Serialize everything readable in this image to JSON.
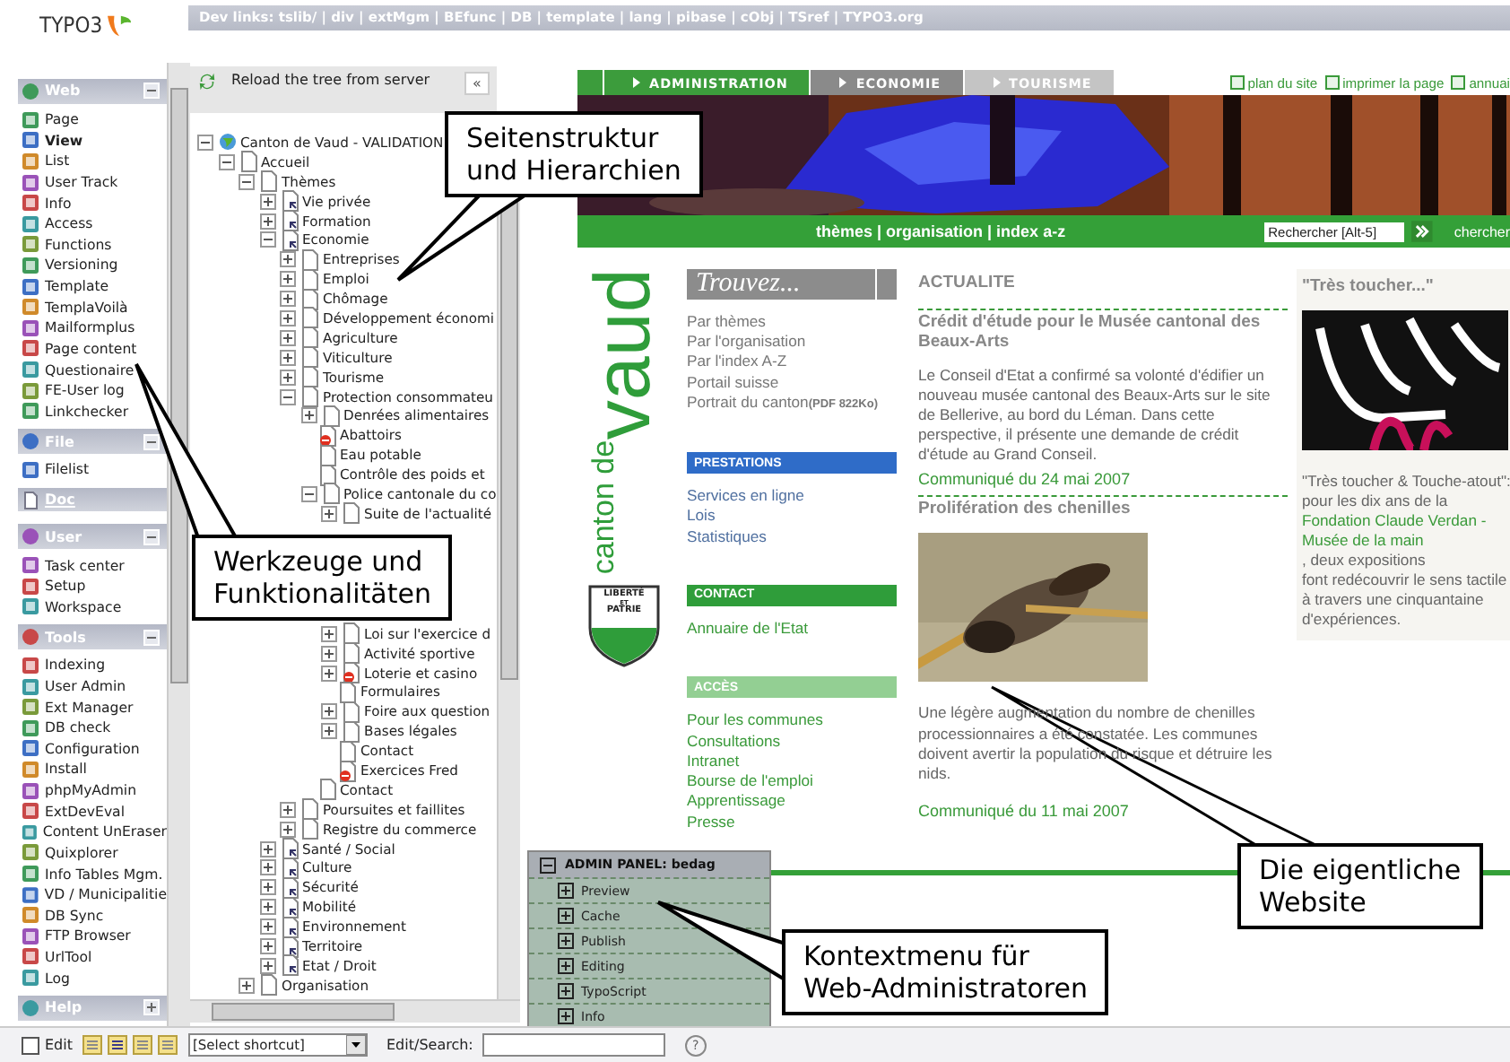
{
  "logo": {
    "text": "TYPO3"
  },
  "dev_links": "Dev links: tslib/ | div | extMgm | BEfunc | DB | template | lang | pibase | cObj | TSref | TYPO3.org",
  "module_menu": {
    "groups": [
      {
        "kind": "group",
        "title": "Web",
        "expanded": true,
        "items": [
          {
            "label": "Page",
            "selected": false
          },
          {
            "label": "View",
            "selected": true
          },
          {
            "label": "List",
            "selected": false
          },
          {
            "label": "User Track",
            "selected": false
          },
          {
            "label": "Info",
            "selected": false
          },
          {
            "label": "Access",
            "selected": false
          },
          {
            "label": "Functions",
            "selected": false
          },
          {
            "label": "Versioning",
            "selected": false
          },
          {
            "label": "Template",
            "selected": false
          },
          {
            "label": "TemplaVoilà",
            "selected": false
          },
          {
            "label": "Mailformplus",
            "selected": false
          },
          {
            "label": "Page content",
            "selected": false
          },
          {
            "label": "Questionaire",
            "selected": false
          },
          {
            "label": "FE-User log",
            "selected": false
          },
          {
            "label": "Linkchecker",
            "selected": false
          }
        ]
      },
      {
        "kind": "group",
        "title": "File",
        "expanded": true,
        "items": [
          {
            "label": "Filelist",
            "selected": false
          }
        ]
      },
      {
        "kind": "link",
        "title": "Doc"
      },
      {
        "kind": "group",
        "title": "User",
        "expanded": true,
        "items": [
          {
            "label": "Task center",
            "selected": false
          },
          {
            "label": "Setup",
            "selected": false
          },
          {
            "label": "Workspace",
            "selected": false
          }
        ]
      },
      {
        "kind": "group",
        "title": "Tools",
        "expanded": true,
        "items": [
          {
            "label": "Indexing",
            "selected": false
          },
          {
            "label": "User Admin",
            "selected": false
          },
          {
            "label": "Ext Manager",
            "selected": false
          },
          {
            "label": "DB check",
            "selected": false
          },
          {
            "label": "Configuration",
            "selected": false
          },
          {
            "label": "Install",
            "selected": false
          },
          {
            "label": "phpMyAdmin",
            "selected": false
          },
          {
            "label": "ExtDevEval",
            "selected": false
          },
          {
            "label": "Content UnEraser",
            "selected": false
          },
          {
            "label": "Quixplorer",
            "selected": false
          },
          {
            "label": "Info Tables Mgm.",
            "selected": false
          },
          {
            "label": "VD / Municipalitie",
            "selected": false
          },
          {
            "label": "DB Sync",
            "selected": false
          },
          {
            "label": "FTP Browser",
            "selected": false
          },
          {
            "label": "UrlTool",
            "selected": false
          },
          {
            "label": "Log",
            "selected": false
          }
        ]
      },
      {
        "kind": "group",
        "title": "Help",
        "expanded": false
      }
    ]
  },
  "page_tree": {
    "reload_label": "Reload the tree from server",
    "collapse_button": "«",
    "nodes": [
      {
        "label": "Canton de Vaud - VALIDATION",
        "kind": "root",
        "expanded": true,
        "children": [
          {
            "label": "Accueil",
            "kind": "page",
            "expanded": true,
            "children": [
              {
                "label": "Thèmes",
                "kind": "page",
                "expanded": true,
                "children": [
                  {
                    "label": "Vie privée",
                    "kind": "shortcut",
                    "expanded": false
                  },
                  {
                    "label": "Formation",
                    "kind": "shortcut",
                    "expanded": false
                  },
                  {
                    "label": "Economie",
                    "kind": "shortcut",
                    "expanded": true,
                    "children": [
                      {
                        "label": "Entreprises",
                        "kind": "page",
                        "expanded": false
                      },
                      {
                        "label": "Emploi",
                        "kind": "page",
                        "expanded": false
                      },
                      {
                        "label": "Chômage",
                        "kind": "page",
                        "expanded": false
                      },
                      {
                        "label": "Développement économi",
                        "kind": "page",
                        "expanded": false
                      },
                      {
                        "label": "Agriculture",
                        "kind": "page",
                        "expanded": false
                      },
                      {
                        "label": "Viticulture",
                        "kind": "page",
                        "expanded": false
                      },
                      {
                        "label": "Tourisme",
                        "kind": "page",
                        "expanded": false
                      },
                      {
                        "label": "Protection consommateu",
                        "kind": "page",
                        "expanded": true,
                        "children": [
                          {
                            "label": "Denrées alimentaires",
                            "kind": "page",
                            "expanded": false
                          },
                          {
                            "label": "Abattoirs",
                            "kind": "hidden"
                          },
                          {
                            "label": "Eau potable",
                            "kind": "page"
                          },
                          {
                            "label": "Contrôle des poids et",
                            "kind": "page"
                          },
                          {
                            "label": "Police cantonale du co",
                            "kind": "page",
                            "expanded": true,
                            "children": [
                              {
                                "label": "Suite de l'actualité",
                                "kind": "page",
                                "expanded": false
                              },
                              {
                                "label": "Loi sur l'exercice d",
                                "kind": "page",
                                "expanded": false
                              },
                              {
                                "label": "Activité sportive",
                                "kind": "page",
                                "expanded": false
                              },
                              {
                                "label": "Loterie et casino",
                                "kind": "hidden",
                                "expanded": false
                              },
                              {
                                "label": "Formulaires",
                                "kind": "page"
                              },
                              {
                                "label": "Foire aux question",
                                "kind": "page",
                                "expanded": false
                              },
                              {
                                "label": "Bases légales",
                                "kind": "page",
                                "expanded": false
                              },
                              {
                                "label": "Contact",
                                "kind": "page"
                              },
                              {
                                "label": "Exercices Fred",
                                "kind": "hidden"
                              }
                            ]
                          },
                          {
                            "label": "Contact",
                            "kind": "page"
                          }
                        ]
                      },
                      {
                        "label": "Poursuites et faillites",
                        "kind": "page",
                        "expanded": false
                      },
                      {
                        "label": "Registre du commerce",
                        "kind": "page",
                        "expanded": false
                      }
                    ]
                  },
                  {
                    "label": "Santé / Social",
                    "kind": "shortcut",
                    "expanded": false
                  },
                  {
                    "label": "Culture",
                    "kind": "shortcut",
                    "expanded": false
                  },
                  {
                    "label": "Sécurité",
                    "kind": "shortcut",
                    "expanded": false
                  },
                  {
                    "label": "Mobilité",
                    "kind": "shortcut",
                    "expanded": false
                  },
                  {
                    "label": "Environnement",
                    "kind": "shortcut",
                    "expanded": false
                  },
                  {
                    "label": "Territoire",
                    "kind": "shortcut",
                    "expanded": false
                  },
                  {
                    "label": "Etat / Droit",
                    "kind": "shortcut",
                    "expanded": false
                  }
                ]
              },
              {
                "label": "Organisation",
                "kind": "page",
                "expanded": false
              }
            ]
          }
        ]
      }
    ]
  },
  "website": {
    "nav_tabs": [
      {
        "label": "ADMINISTRATION",
        "color": "#3c9c3c"
      },
      {
        "label": "ECONOMIE",
        "color": "#8a8a8a"
      },
      {
        "label": "TOURISME",
        "color": "#c4c4c4"
      }
    ],
    "utility_links": [
      "plan du site",
      "imprimer la page",
      "annuai"
    ],
    "theme_links": "thèmes | organisation | index a-z",
    "search": {
      "value": "Rechercher [Alt-5]",
      "label": "chercher"
    },
    "logo": {
      "small": "canton de",
      "large": "vaud",
      "motto": [
        "LIBERTÉ",
        "ET",
        "PATRIE"
      ]
    },
    "finder": {
      "title": "Trouvez...",
      "links": [
        {
          "label": "Par thèmes"
        },
        {
          "label": "Par l'organisation"
        },
        {
          "label": "Par l'index A-Z"
        },
        {
          "label": "Portail suisse"
        },
        {
          "label": "Portrait du canton",
          "note": "(PDF 822Ko)"
        }
      ]
    },
    "sections": [
      {
        "title": "PRESTATIONS",
        "color": "#2f6cc8",
        "links": [
          "Services en ligne",
          "Lois",
          "Statistiques"
        ]
      },
      {
        "title": "CONTACT",
        "color": "#2f9d3a",
        "links": [
          "Annuaire de l'Etat"
        ]
      },
      {
        "title": "ACCÈS",
        "color": "#93cf93",
        "links": [
          "Pour les communes",
          "Consultations",
          "Intranet",
          "Bourse de l'emploi",
          "Apprentissage",
          "Presse"
        ]
      }
    ],
    "news": {
      "heading": "ACTUALITE",
      "articles": [
        {
          "title": "Crédit d'étude pour le Musée cantonal des Beaux-Arts",
          "picture": false,
          "body": "Le Conseil d'Etat a confirmé sa volonté d'édifier un nouveau musée cantonal des Beaux-Arts sur le site de Bellerive, au bord du Léman. Dans cette perspective, il présente une demande de crédit d'étude au Grand Conseil.",
          "date": "Communiqué du 24 mai 2007"
        },
        {
          "title": "Prolifération des chenilles",
          "picture": true,
          "body": "Une légère augmentation du nombre de chenilles processionnaires a été constatée. Les communes doivent avertir la population du risque et détruire les nids.",
          "date": "Communiqué du 11 mai 2007"
        }
      ]
    },
    "feature": {
      "title": "\"Très toucher...\"",
      "intro": "\"Très toucher & Touche-atout\": pour les dix ans de la",
      "link": "Fondation Claude Verdan - Musée de la main",
      "after": ", deux expositions",
      "end": "font redécouvrir le sens tactile à travers une cinquantaine d'expériences."
    }
  },
  "admin_panel": {
    "title": "ADMIN PANEL: bedag",
    "expanded": true,
    "items": [
      {
        "label": "Preview",
        "expanded": false
      },
      {
        "label": "Cache",
        "expanded": false
      },
      {
        "label": "Publish",
        "expanded": false
      },
      {
        "label": "Editing",
        "expanded": false
      },
      {
        "label": "TypoScript",
        "expanded": false
      },
      {
        "label": "Info",
        "expanded": false
      }
    ]
  },
  "bottom_bar": {
    "edit_label": "Edit",
    "edit_checked": false,
    "shortcut": "[Select shortcut]",
    "search_label": "Edit/Search:",
    "help": "?"
  },
  "callouts": [
    {
      "lines": [
        "Seitenstruktur",
        "und Hierarchien"
      ]
    },
    {
      "lines": [
        "Werkzeuge und",
        "Funktionalitäten"
      ]
    },
    {
      "lines": [
        "Die eigentliche",
        "Website"
      ]
    },
    {
      "lines": [
        "Kontextmenu für",
        "Web-Administratoren"
      ]
    }
  ]
}
